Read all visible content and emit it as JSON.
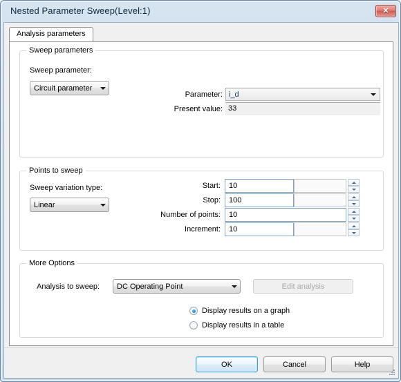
{
  "window": {
    "title": "Nested Parameter Sweep(Level:1)",
    "close_icon": "close-icon",
    "close_glyph": "✕"
  },
  "tabs": [
    {
      "label": "Analysis parameters",
      "selected": true
    }
  ],
  "sweep_parameters": {
    "group_title": "Sweep parameters",
    "sweep_parameter_label": "Sweep parameter:",
    "sweep_parameter_value": "Circuit parameter",
    "parameter_label": "Parameter:",
    "parameter_value": "i_d",
    "present_value_label": "Present value:",
    "present_value": "33"
  },
  "points_to_sweep": {
    "group_title": "Points to sweep",
    "variation_type_label": "Sweep variation type:",
    "variation_type_value": "Linear",
    "rows": [
      {
        "label": "Start:",
        "value": "10",
        "unit": ""
      },
      {
        "label": "Stop:",
        "value": "100",
        "unit": ""
      },
      {
        "label": "Number of points:",
        "value": "10",
        "unit": ""
      },
      {
        "label": "Increment:",
        "value": "10",
        "unit": ""
      }
    ]
  },
  "more_options": {
    "group_title": "More Options",
    "analysis_label": "Analysis to sweep:",
    "analysis_value": "DC Operating Point",
    "edit_analysis_label": "Edit analysis",
    "edit_analysis_disabled": true,
    "radios": [
      {
        "label": "Display results on a graph",
        "selected": true
      },
      {
        "label": "Display results in a table",
        "selected": false
      }
    ]
  },
  "footer": {
    "ok_label": "OK",
    "cancel_label": "Cancel",
    "help_label": "Help"
  },
  "colors": {
    "frame": "#c8d9ea",
    "client_bg": "#f0f0f0",
    "page_bg": "#ffffff",
    "accent_blue": "#3c9fd6",
    "close_red": "#cf5a51",
    "input_border": "#7ea3c4",
    "group_border": "#d8d8d8"
  }
}
